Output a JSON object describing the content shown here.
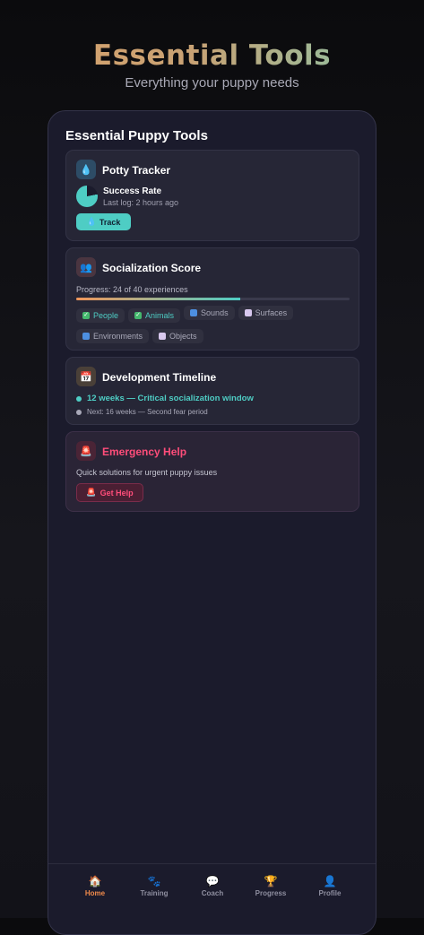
{
  "hero": {
    "title": "Essential Tools",
    "subtitle": "Everything your puppy needs"
  },
  "section_title": "Essential Puppy Tools",
  "potty": {
    "icon": "💧",
    "title": "Potty Tracker",
    "rate_label": "Success Rate",
    "last_log": "Last log: 2 hours ago",
    "success_rate_fraction": 0.78,
    "button_icon": "💧",
    "button_label": "Track"
  },
  "socialization": {
    "icon": "👥",
    "title": "Socialization Score",
    "progress_text": "Progress: 24 of 40 experiences",
    "progress_fraction": 0.6,
    "chips": [
      {
        "icon": "✓",
        "label": "People",
        "done": true
      },
      {
        "icon": "✓",
        "label": "Animals",
        "done": true
      },
      {
        "icon": "🔄",
        "label": "Sounds",
        "done": false
      },
      {
        "icon": "⬜",
        "label": "Surfaces",
        "done": false
      },
      {
        "icon": "🔄",
        "label": "Environments",
        "done": false
      },
      {
        "icon": "⬜",
        "label": "Objects",
        "done": false
      }
    ]
  },
  "timeline": {
    "icon": "📅",
    "title": "Development Timeline",
    "current": "12 weeks — Critical socialization window",
    "next": "Next: 16 weeks — Second fear period"
  },
  "emergency": {
    "icon": "🚨",
    "title": "Emergency Help",
    "description": "Quick solutions for urgent puppy issues",
    "button_icon": "🚨",
    "button_label": "Get Help"
  },
  "nav": [
    {
      "icon": "🏠",
      "label": "Home",
      "active": true
    },
    {
      "icon": "🐾",
      "label": "Training",
      "active": false
    },
    {
      "icon": "💬",
      "label": "Coach",
      "active": false
    },
    {
      "icon": "🏆",
      "label": "Progress",
      "active": false
    },
    {
      "icon": "👤",
      "label": "Profile",
      "active": false
    }
  ],
  "colors": {
    "accent_teal": "#4ecdc4",
    "accent_orange": "#f08a4b",
    "emergency_red": "#ff4d7a",
    "card_bg": "#262636",
    "phone_bg": "#1b1b2c"
  }
}
